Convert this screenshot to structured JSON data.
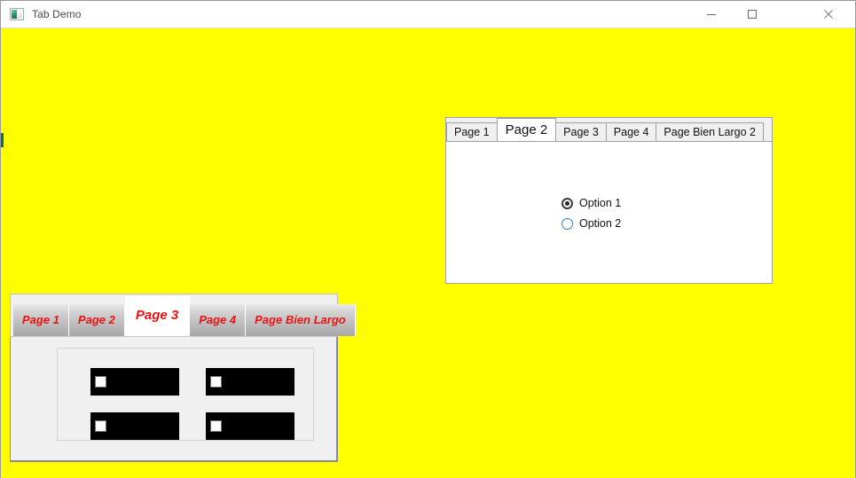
{
  "window": {
    "title": "Tab Demo",
    "icon": "app-picture-icon",
    "background_color": "#ffff00",
    "titlebar_color": "#ffffff",
    "controls": {
      "minimize": "minimize-icon",
      "maximize": "maximize-icon",
      "close": "close-icon"
    }
  },
  "top_tab_control": {
    "tabs": [
      {
        "label": "Page 1",
        "selected": false
      },
      {
        "label": "Page 2",
        "selected": true
      },
      {
        "label": "Page 3",
        "selected": false
      },
      {
        "label": "Page 4",
        "selected": false
      },
      {
        "label": "Page Bien Largo 2",
        "selected": false
      }
    ],
    "selected_tab": "Page 2",
    "page_background": "#ffffff",
    "radios": [
      {
        "label": "Option 1",
        "checked": true,
        "ring_color": "#3c3c3c"
      },
      {
        "label": "Option 2",
        "checked": false,
        "ring_color": "#2a7fd4"
      }
    ]
  },
  "bottom_tab_control": {
    "tabs": [
      {
        "label": "Page 1",
        "selected": false
      },
      {
        "label": "Page 2",
        "selected": false
      },
      {
        "label": "Page 3",
        "selected": true
      },
      {
        "label": "Page 4",
        "selected": false
      },
      {
        "label": "Page Bien Largo",
        "selected": false
      }
    ],
    "selected_tab": "Page 3",
    "tab_text_color": "#ee1111",
    "page_background": "#f0f0f0",
    "checkboxes": [
      {
        "label": "",
        "checked": false,
        "row_background": "#000000"
      },
      {
        "label": "",
        "checked": false,
        "row_background": "#000000"
      },
      {
        "label": "",
        "checked": false,
        "row_background": "#000000"
      },
      {
        "label": "",
        "checked": false,
        "row_background": "#000000"
      }
    ]
  }
}
